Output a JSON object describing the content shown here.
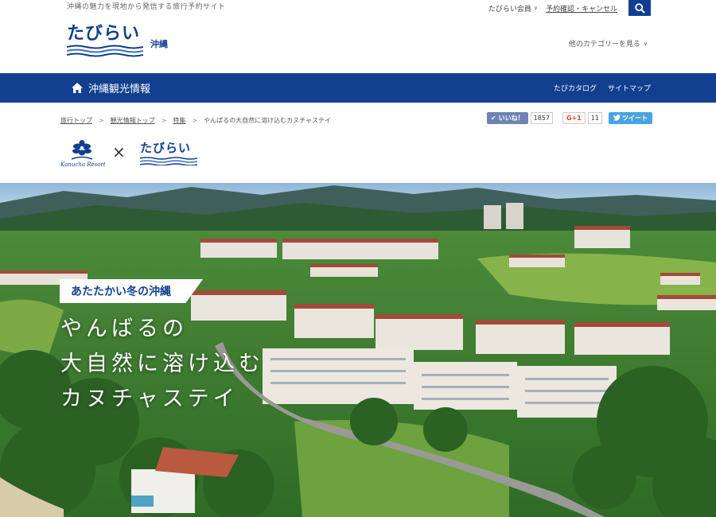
{
  "header": {
    "tagline": "沖縄の魅力を現地から発信する旅行予約サイト",
    "member_label": "たびらい会員",
    "reserve_label": "予約確認・キャンセル",
    "logo_text": "たびらい",
    "region_label": "沖縄",
    "other_category_label": "他のカテゴリーを見る"
  },
  "nav": {
    "home_label": "沖縄観光情報",
    "right_items": [
      "たびカタログ",
      "サイトマップ"
    ]
  },
  "breadcrumb": {
    "items": [
      "旅行トップ",
      "観光情報トップ",
      "特集",
      "やんばるの大自然に溶け込むカヌチャステイ"
    ],
    "separator": ">"
  },
  "social": {
    "like_label": "いいね！",
    "like_count": "1857",
    "gplus_label": "G+1",
    "gplus_count": "11",
    "tweet_label": "ツイート"
  },
  "collab": {
    "partner_text": "Kanucha Resort",
    "times": "×",
    "logo_text": "たびらい"
  },
  "hero": {
    "badge": "あたたかい冬の沖縄",
    "title_lines": [
      "やんばるの",
      "大自然に溶け込む",
      "カヌチャステイ"
    ]
  },
  "colors": {
    "brand": "#123f8f",
    "like": "#6d84b4",
    "tweet": "#4aa3df",
    "gplus": "#d34836"
  }
}
